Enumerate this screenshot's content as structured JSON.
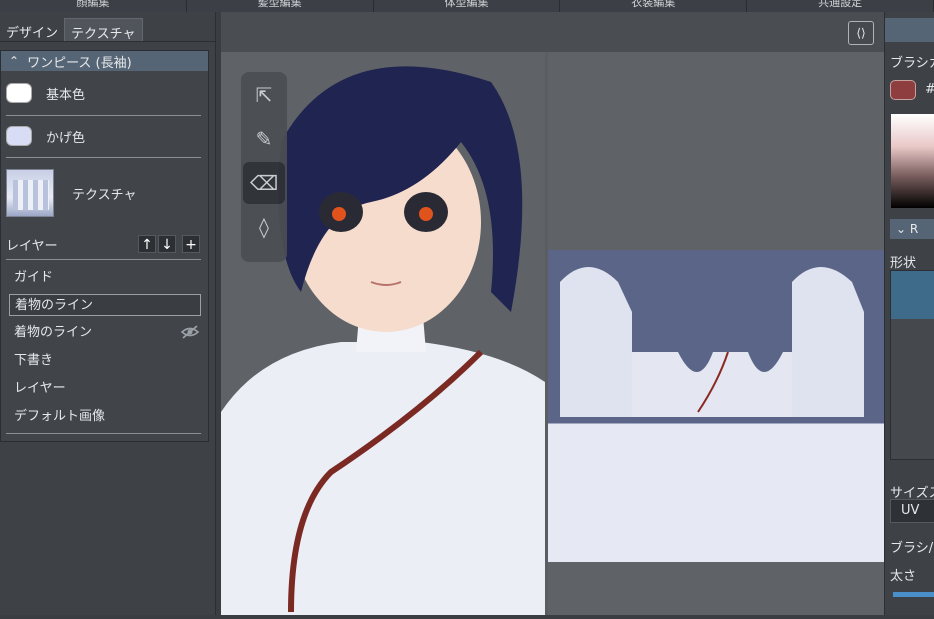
{
  "top_tabs": [
    "顔編集",
    "髪型編集",
    "体型編集",
    "衣装編集",
    "共通設定"
  ],
  "left_panel": {
    "tabs": [
      "デザイン",
      "テクスチャ"
    ],
    "active_tab": "テクスチャ",
    "section_title": "ワンピース (長袖)",
    "base_color_label": "基本色",
    "base_color": "#ffffff",
    "shadow_color_label": "かげ色",
    "shadow_color": "#d8dcf4",
    "texture_label": "テクスチャ",
    "layer_header": "レイヤー",
    "layers": [
      {
        "label": "ガイド",
        "selected": false,
        "hidden": false
      },
      {
        "label": "着物のライン",
        "selected": true,
        "hidden": false
      },
      {
        "label": "着物のライン",
        "selected": false,
        "hidden": true
      },
      {
        "label": "下書き",
        "selected": false,
        "hidden": false
      },
      {
        "label": "レイヤー",
        "selected": false,
        "hidden": false
      },
      {
        "label": "デフォルト画像",
        "selected": false,
        "hidden": false
      }
    ]
  },
  "tools": [
    "select-tool",
    "pen-tool",
    "eraser-tool",
    "fill-tool"
  ],
  "active_tool": "eraser-tool",
  "right_panel": {
    "brush_color_label": "ブラシカ",
    "brush_color": "#8e3e3e",
    "hex_prefix": "#",
    "collapsed_section": "R",
    "shape_label": "形状",
    "size_label": "サイズス",
    "uv_option": "UV",
    "brush_label": "ブラシ/",
    "thickness_label": "太さ"
  }
}
